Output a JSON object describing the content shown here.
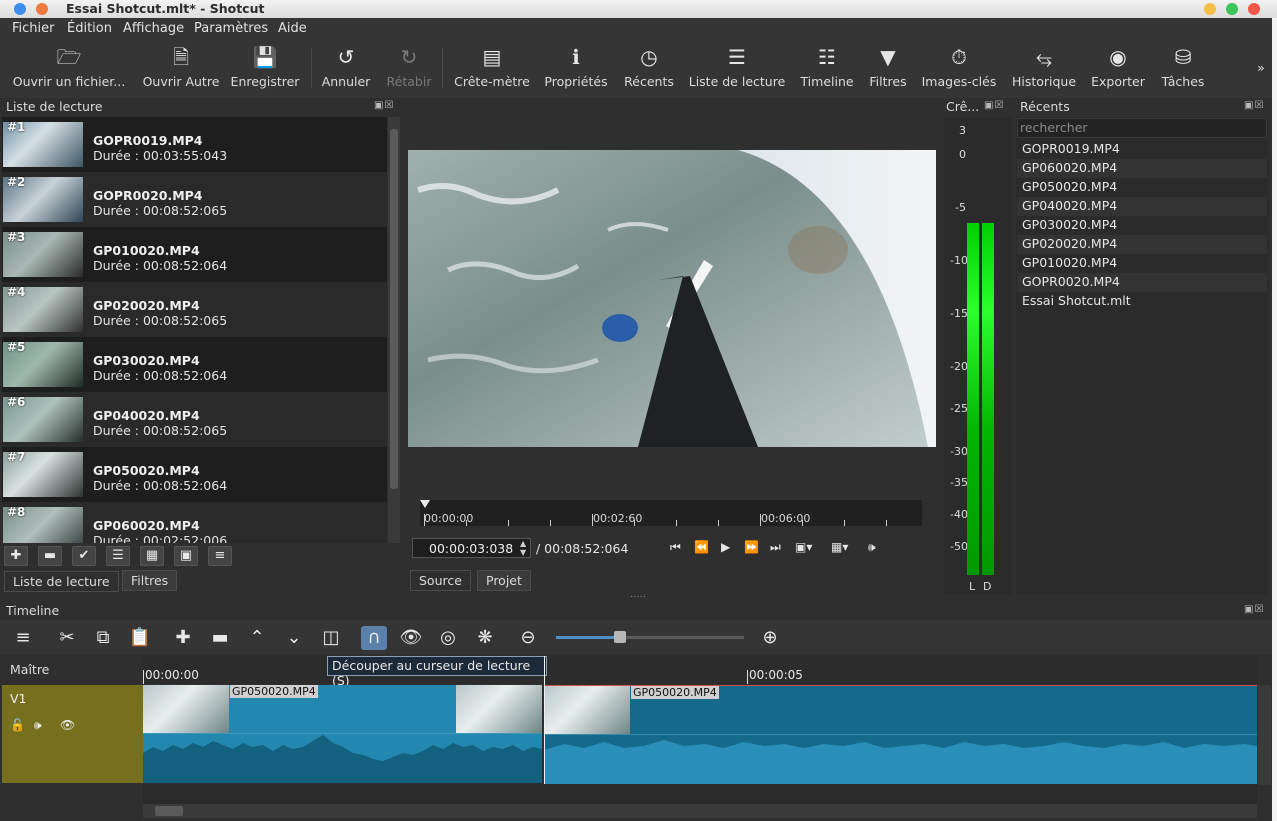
{
  "window": {
    "title": "Essai Shotcut.mlt* - Shotcut"
  },
  "menu": [
    "Fichier",
    "Édition",
    "Affichage",
    "Paramètres",
    "Aide"
  ],
  "toolbar": [
    {
      "label": "Ouvrir un fichier...",
      "icon": "folder-icon"
    },
    {
      "label": "Ouvrir Autre",
      "icon": "file-plus-icon"
    },
    {
      "label": "Enregistrer",
      "icon": "save-icon"
    },
    {
      "label": "Annuler",
      "icon": "undo-icon"
    },
    {
      "label": "Rétabir",
      "icon": "redo-icon"
    },
    {
      "label": "Crête-mètre",
      "icon": "peak-meter-icon"
    },
    {
      "label": "Propriétés",
      "icon": "info-icon"
    },
    {
      "label": "Récents",
      "icon": "clock-icon"
    },
    {
      "label": "Liste de lecture",
      "icon": "list-icon"
    },
    {
      "label": "Timeline",
      "icon": "timeline-icon"
    },
    {
      "label": "Filtres",
      "icon": "filter-icon"
    },
    {
      "label": "Images-clés",
      "icon": "stopwatch-icon"
    },
    {
      "label": "Historique",
      "icon": "history-icon"
    },
    {
      "label": "Exporter",
      "icon": "export-icon"
    },
    {
      "label": "Tâches",
      "icon": "jobs-icon"
    }
  ],
  "playlist": {
    "title": "Liste de lecture",
    "items": [
      {
        "num": "#1",
        "name": "GOPR0019.MP4",
        "duration": "Durée : 00:03:55:043"
      },
      {
        "num": "#2",
        "name": "GOPR0020.MP4",
        "duration": "Durée : 00:08:52:065"
      },
      {
        "num": "#3",
        "name": "GP010020.MP4",
        "duration": "Durée : 00:08:52:064"
      },
      {
        "num": "#4",
        "name": "GP020020.MP4",
        "duration": "Durée : 00:08:52:065"
      },
      {
        "num": "#5",
        "name": "GP030020.MP4",
        "duration": "Durée : 00:08:52:064"
      },
      {
        "num": "#6",
        "name": "GP040020.MP4",
        "duration": "Durée : 00:08:52:065"
      },
      {
        "num": "#7",
        "name": "GP050020.MP4",
        "duration": "Durée : 00:08:52:064"
      },
      {
        "num": "#8",
        "name": "GP060020.MP4",
        "duration": "Durée : 00:02:52:006"
      }
    ],
    "tabs": [
      "Liste de lecture",
      "Filtres"
    ]
  },
  "player": {
    "ruler": [
      "00:00:00",
      "00:02:60",
      "00:06:00"
    ],
    "position": "00:00:03:038",
    "total": "/ 00:08:52:064",
    "tabs": [
      "Source",
      "Projet"
    ]
  },
  "meter": {
    "title": "Crê...",
    "scale": [
      "3",
      "0",
      "-5",
      "-10",
      "-15",
      "-20",
      "-25",
      "-30",
      "-35",
      "-40",
      "-50"
    ],
    "channels": [
      "L",
      "D"
    ]
  },
  "recent": {
    "title": "Récents",
    "search_placeholder": "rechercher",
    "items": [
      "GOPR0019.MP4",
      "GP060020.MP4",
      "GP050020.MP4",
      "GP040020.MP4",
      "GP030020.MP4",
      "GP020020.MP4",
      "GP010020.MP4",
      "GOPR0020.MP4",
      "Essai Shotcut.mlt"
    ]
  },
  "timeline": {
    "title": "Timeline",
    "tooltip": "Découper au curseur de lecture (S)",
    "ruler": [
      "00:00:00",
      "00:00:05"
    ],
    "tracks": {
      "master": "Maître",
      "v1": "V1"
    },
    "clips": [
      "GP050020.MP4",
      "GP050020.MP4"
    ]
  }
}
